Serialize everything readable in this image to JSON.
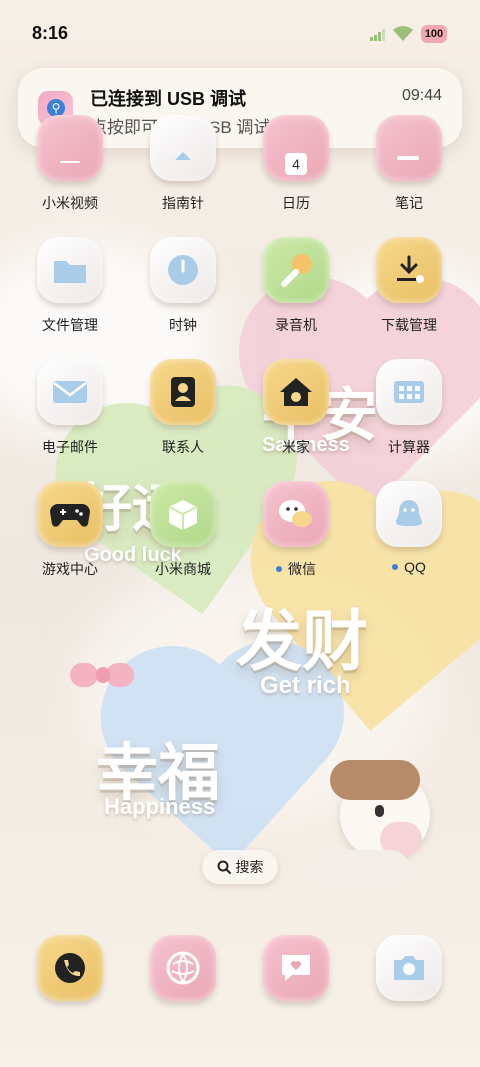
{
  "status_bar": {
    "time": "8:16",
    "battery": "100"
  },
  "notification": {
    "title": "已连接到 USB 调试",
    "body": "点按即可关闭 USB 调试",
    "time": "09:44",
    "icon": "usb-debug-icon"
  },
  "wallpaper": {
    "words": [
      {
        "cn": "平安",
        "en": "Safeness"
      },
      {
        "cn": "好运",
        "en": "Good luck"
      },
      {
        "cn": "发财",
        "en": "Get rich"
      },
      {
        "cn": "幸福",
        "en": "Happiness"
      }
    ]
  },
  "apps": [
    {
      "label": "小米视频",
      "icon": "video-icon"
    },
    {
      "label": "指南针",
      "icon": "compass-icon"
    },
    {
      "label": "日历",
      "icon": "calendar-icon",
      "badge_text": "4"
    },
    {
      "label": "笔记",
      "icon": "notes-icon"
    },
    {
      "label": "文件管理",
      "icon": "folder-icon"
    },
    {
      "label": "时钟",
      "icon": "clock-icon"
    },
    {
      "label": "录音机",
      "icon": "recorder-icon"
    },
    {
      "label": "下载管理",
      "icon": "download-icon"
    },
    {
      "label": "电子邮件",
      "icon": "mail-icon"
    },
    {
      "label": "联系人",
      "icon": "contacts-icon"
    },
    {
      "label": "米家",
      "icon": "mihome-icon"
    },
    {
      "label": "计算器",
      "icon": "calculator-icon"
    },
    {
      "label": "游戏中心",
      "icon": "gamepad-icon"
    },
    {
      "label": "小米商城",
      "icon": "store-icon"
    },
    {
      "label": "微信",
      "icon": "wechat-icon"
    },
    {
      "label": "QQ",
      "icon": "qq-icon"
    }
  ],
  "search": {
    "label": "搜索"
  },
  "dock": [
    {
      "icon": "phone-icon"
    },
    {
      "icon": "browser-icon"
    },
    {
      "icon": "messages-icon"
    },
    {
      "icon": "camera-icon"
    }
  ]
}
